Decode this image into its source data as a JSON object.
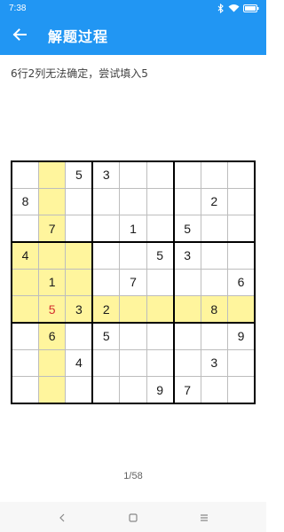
{
  "status_bar": {
    "time": "7:38"
  },
  "toolbar": {
    "title": "解题过程"
  },
  "hint": "6行2列无法确定，尝试填入5",
  "pager": "1/58",
  "colors": {
    "primary": "#2196f3",
    "highlight": "#fff59d",
    "trial_digit": "#d32f2f"
  },
  "icons": {
    "back": "arrow-left-icon",
    "bluetooth": "bluetooth-icon",
    "wifi": "wifi-icon",
    "battery": "battery-icon",
    "nav_back": "nav-back-icon",
    "nav_home": "nav-home-icon",
    "nav_menu": "nav-menu-icon"
  },
  "sudoku": {
    "rows": [
      [
        "",
        "",
        "5",
        "3",
        "",
        "",
        "",
        "",
        ""
      ],
      [
        "8",
        "",
        "",
        "",
        "",
        "",
        "",
        "2",
        ""
      ],
      [
        "",
        "7",
        "",
        "",
        "1",
        "",
        "5",
        "",
        ""
      ],
      [
        "4",
        "",
        "",
        "",
        "",
        "5",
        "3",
        "",
        ""
      ],
      [
        "",
        "1",
        "",
        "",
        "7",
        "",
        "",
        "",
        "6"
      ],
      [
        "",
        "5",
        "3",
        "2",
        "",
        "",
        "",
        "8",
        ""
      ],
      [
        "",
        "6",
        "",
        "5",
        "",
        "",
        "",
        "",
        "9"
      ],
      [
        "",
        "",
        "4",
        "",
        "",
        "",
        "",
        "3",
        ""
      ],
      [
        "",
        "",
        "",
        "",
        "",
        "9",
        "7",
        "",
        ""
      ]
    ],
    "trial_cell": {
      "row": 6,
      "col": 2,
      "value": "5"
    },
    "highlighted": {
      "row": 6,
      "col": 2,
      "box": 4
    }
  }
}
